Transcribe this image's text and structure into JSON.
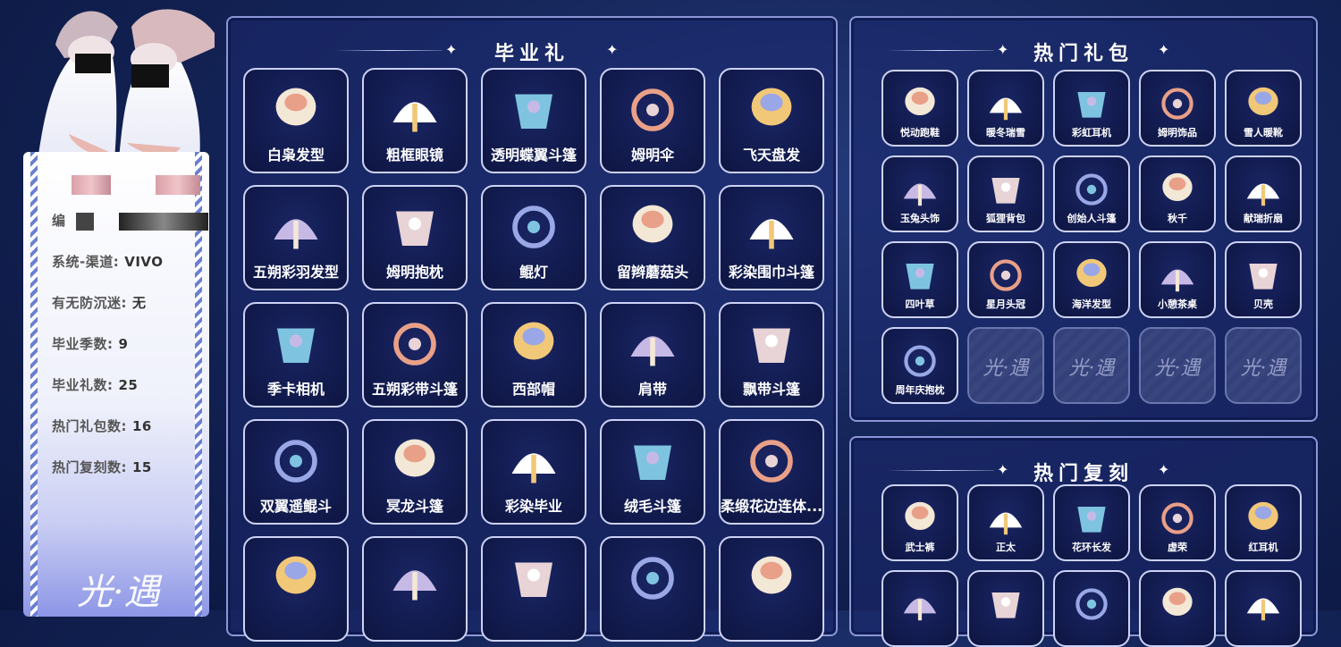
{
  "profile": {
    "id_label": "编",
    "rows": [
      {
        "label": "系统-渠道:",
        "value": "VIVO"
      },
      {
        "label": "有无防沉迷:",
        "value": "无"
      },
      {
        "label": "毕业季数:",
        "value": "9"
      },
      {
        "label": "毕业礼数:",
        "value": "25"
      },
      {
        "label": "热门礼包数:",
        "value": "16"
      },
      {
        "label": "热门复刻数:",
        "value": "15"
      }
    ],
    "brand_watermark": "光·遇"
  },
  "graduation_panel": {
    "title": "毕业礼",
    "items": [
      {
        "label": "白枭发型",
        "icon": "owl-hair-icon"
      },
      {
        "label": "粗框眼镜",
        "icon": "glasses-icon"
      },
      {
        "label": "透明蝶翼斗篷",
        "icon": "butterfly-cape-icon"
      },
      {
        "label": "姆明伞",
        "icon": "umbrella-icon"
      },
      {
        "label": "飞天盘发",
        "icon": "bun-hair-icon"
      },
      {
        "label": "五朔彩羽发型",
        "icon": "feather-hair-icon"
      },
      {
        "label": "姆明抱枕",
        "icon": "moomin-pillow-icon"
      },
      {
        "label": "鲲灯",
        "icon": "lantern-icon"
      },
      {
        "label": "留辫蘑菇头",
        "icon": "mushroom-hair-icon"
      },
      {
        "label": "彩染围巾斗篷",
        "icon": "scarf-cape-icon"
      },
      {
        "label": "季卡相机",
        "icon": "camera-icon"
      },
      {
        "label": "五朔彩带斗篷",
        "icon": "ribbon-cape-icon"
      },
      {
        "label": "西部帽",
        "icon": "cowboy-hat-icon"
      },
      {
        "label": "肩带",
        "icon": "shoulder-strap-icon"
      },
      {
        "label": "飘带斗篷",
        "icon": "streamer-cape-icon"
      },
      {
        "label": "双翼遥鲲斗",
        "icon": "wing-cape-icon"
      },
      {
        "label": "冥龙斗篷",
        "icon": "dragon-cape-icon"
      },
      {
        "label": "彩染毕业",
        "icon": "mask-icon"
      },
      {
        "label": "绒毛斗篷",
        "icon": "fur-cape-icon"
      },
      {
        "label": "柔缎花边连体...",
        "icon": "dress-icon"
      },
      {
        "label": "",
        "icon": "cape-icon"
      },
      {
        "label": "",
        "icon": "dress-icon"
      },
      {
        "label": "",
        "icon": "necklace-icon"
      },
      {
        "label": "",
        "icon": "deer-mask-icon"
      },
      {
        "label": "",
        "icon": "fluffy-cape-icon"
      }
    ]
  },
  "hot_packs_panel": {
    "title": "热门礼包",
    "items": [
      {
        "label": "悦动跑鞋",
        "icon": "shoe-icon"
      },
      {
        "label": "暖冬瑞雪",
        "icon": "snow-cape-icon"
      },
      {
        "label": "彩虹耳机",
        "icon": "headphones-icon"
      },
      {
        "label": "姆明饰品",
        "icon": "tail-icon"
      },
      {
        "label": "雪人暖靴",
        "icon": "boots-icon"
      },
      {
        "label": "玉兔头饰",
        "icon": "rabbit-icon"
      },
      {
        "label": "狐狸背包",
        "icon": "fox-icon"
      },
      {
        "label": "创始人斗篷",
        "icon": "founder-cape-icon"
      },
      {
        "label": "秋千",
        "icon": "swing-icon"
      },
      {
        "label": "献瑞折扇",
        "icon": "fan-icon"
      },
      {
        "label": "四叶草",
        "icon": "clover-icon"
      },
      {
        "label": "星月头冠",
        "icon": "crown-icon"
      },
      {
        "label": "海洋发型",
        "icon": "ocean-hair-icon"
      },
      {
        "label": "小憩茶桌",
        "icon": "teapot-icon"
      },
      {
        "label": "贝壳",
        "icon": "shell-icon"
      },
      {
        "label": "周年庆抱枕",
        "icon": "bear-pillow-icon"
      },
      {
        "label": "",
        "icon": "empty"
      },
      {
        "label": "",
        "icon": "empty"
      },
      {
        "label": "",
        "icon": "empty"
      },
      {
        "label": "",
        "icon": "empty"
      }
    ],
    "empty_watermark": "光·遇"
  },
  "hot_reruns_panel": {
    "title": "热门复刻",
    "items": [
      {
        "label": "武士裤",
        "icon": "pants-icon"
      },
      {
        "label": "正太",
        "icon": "short-hair-icon"
      },
      {
        "label": "花环长发",
        "icon": "flower-hair-icon"
      },
      {
        "label": "虚荣",
        "icon": "vanity-hair-icon"
      },
      {
        "label": "红耳机",
        "icon": "red-headphones-icon"
      },
      {
        "label": "",
        "icon": "straw-hat-icon"
      },
      {
        "label": "",
        "icon": "hat-icon"
      },
      {
        "label": "",
        "icon": "cape-icon"
      },
      {
        "label": "",
        "icon": "hair-icon"
      },
      {
        "label": "",
        "icon": "cape-icon"
      }
    ]
  },
  "colors": {
    "background": "#142457",
    "panel_border": "#8b97d6",
    "tile_border": "#cdd3f5",
    "tile_bg": "#0d1541"
  }
}
